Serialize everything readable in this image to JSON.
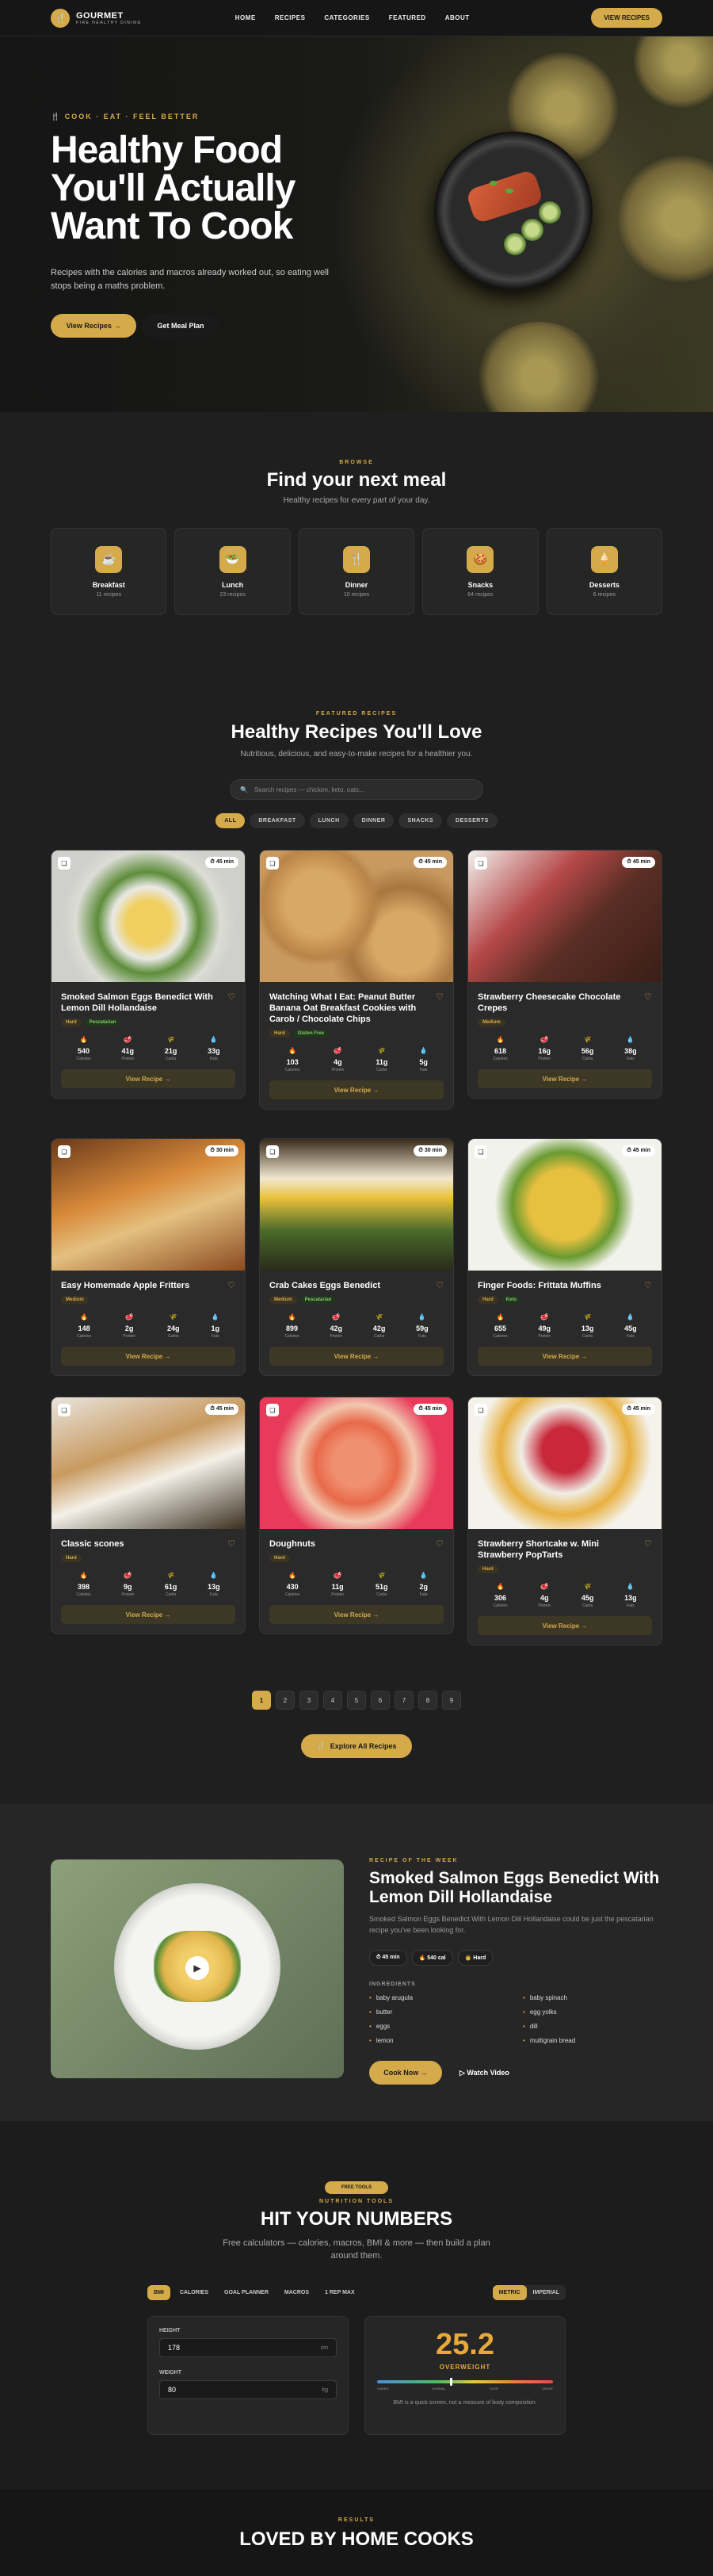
{
  "nav": {
    "brand": "GOURMET",
    "tagline": "FIRE HEALTHY DINING",
    "links": [
      "HOME",
      "RECIPES",
      "CATEGORIES",
      "FEATURED",
      "ABOUT"
    ],
    "cta": "VIEW RECIPES"
  },
  "hero": {
    "eyebrow": "🍴 COOK · EAT · FEEL BETTER",
    "title": "Healthy Food You'll Actually Want To Cook",
    "subtitle": "Recipes with the calories and macros already worked out, so eating well stops being a maths problem.",
    "btn_primary": "View Recipes →",
    "btn_secondary": "Get Meal Plan"
  },
  "browse": {
    "eyebrow": "BROWSE",
    "title": "Find your next meal",
    "subtitle": "Healthy recipes for every part of your day.",
    "categories": [
      {
        "name": "Breakfast",
        "count": "11 recipes"
      },
      {
        "name": "Lunch",
        "count": "23 recipes"
      },
      {
        "name": "Dinner",
        "count": "10 recipes"
      },
      {
        "name": "Snacks",
        "count": "64 recipes"
      },
      {
        "name": "Desserts",
        "count": "6 recipes"
      }
    ]
  },
  "featured": {
    "eyebrow": "FEATURED RECIPES",
    "title": "Healthy Recipes You'll Love",
    "subtitle": "Nutritious, delicious, and easy-to-make recipes for a healthier you.",
    "search_placeholder": "Search recipes — chicken, keto, oats...",
    "filters": [
      "ALL",
      "BREAKFAST",
      "LUNCH",
      "DINNER",
      "SNACKS",
      "DESSERTS"
    ],
    "macro_labels": [
      "Calories",
      "Protein",
      "Carbs",
      "Fats"
    ],
    "view_label": "View Recipe →",
    "recipes": [
      {
        "title": "Smoked Salmon Eggs Benedict With Lemon Dill Hollandaise",
        "time": "45 min",
        "tags": [
          "Hard",
          "Pescatarian"
        ],
        "macros": [
          "540",
          "41g",
          "21g",
          "33g"
        ]
      },
      {
        "title": "Watching What I Eat: Peanut Butter Banana Oat Breakfast Cookies with Carob / Chocolate Chips",
        "time": "45 min",
        "tags": [
          "Hard",
          "Gluten Free"
        ],
        "macros": [
          "103",
          "4g",
          "11g",
          "5g"
        ]
      },
      {
        "title": "Strawberry Cheesecake Chocolate Crepes",
        "time": "45 min",
        "tags": [
          "Medium"
        ],
        "macros": [
          "618",
          "16g",
          "56g",
          "38g"
        ]
      },
      {
        "title": "Easy Homemade Apple Fritters",
        "time": "30 min",
        "tags": [
          "Medium"
        ],
        "macros": [
          "148",
          "2g",
          "24g",
          "1g"
        ]
      },
      {
        "title": "Crab Cakes Eggs Benedict",
        "time": "30 min",
        "tags": [
          "Medium",
          "Pescatarian"
        ],
        "macros": [
          "899",
          "42g",
          "42g",
          "59g"
        ]
      },
      {
        "title": "Finger Foods: Frittata Muffins",
        "time": "45 min",
        "tags": [
          "Hard",
          "Keto"
        ],
        "macros": [
          "655",
          "49g",
          "13g",
          "45g"
        ]
      },
      {
        "title": "Classic scones",
        "time": "45 min",
        "tags": [
          "Hard"
        ],
        "macros": [
          "398",
          "9g",
          "61g",
          "13g"
        ]
      },
      {
        "title": "Doughnuts",
        "time": "45 min",
        "tags": [
          "Hard"
        ],
        "macros": [
          "430",
          "11g",
          "51g",
          "2g"
        ]
      },
      {
        "title": "Strawberry Shortcake w. Mini Strawberry PopTarts",
        "time": "45 min",
        "tags": [
          "Hard"
        ],
        "macros": [
          "306",
          "4g",
          "45g",
          "13g"
        ]
      }
    ],
    "pages": [
      "1",
      "2",
      "3",
      "4",
      "5",
      "6",
      "7",
      "8",
      "9"
    ],
    "explore": "Explore All Recipes"
  },
  "week": {
    "eyebrow": "RECIPE OF THE WEEK",
    "title": "Smoked Salmon Eggs Benedict With Lemon Dill Hollandaise",
    "desc": "Smoked Salmon Eggs Benedict With Lemon Dill Hollandaise could be just the pescatarian recipe you've been looking for.",
    "pills": [
      "⏱ 45 min",
      "🔥 540 cal",
      "👨 Hard"
    ],
    "ingredients_label": "INGREDIENTS",
    "ingredients": [
      "baby arugula",
      "butter",
      "eggs",
      "lemon",
      "baby spinach",
      "egg yolks",
      "dill",
      "multigrain bread"
    ],
    "cook": "Cook Now →",
    "watch": "▷ Watch Video"
  },
  "tools": {
    "badge": "FREE TOOLS",
    "eyebrow": "NUTRITION TOOLS",
    "title": "HIT YOUR NUMBERS",
    "subtitle": "Free calculators — calories, macros, BMI & more — then build a plan around them.",
    "tabs": [
      "BMI",
      "CALORIES",
      "GOAL PLANNER",
      "MACROS",
      "1 REP MAX"
    ],
    "units": [
      "METRIC",
      "IMPERIAL"
    ],
    "height_label": "HEIGHT",
    "height_value": "178",
    "height_unit": "cm",
    "weight_label": "WEIGHT",
    "weight_value": "80",
    "weight_unit": "kg",
    "bmi": "25.2",
    "bmi_category": "OVERWEIGHT",
    "scale": [
      "UNDER",
      "NORMAL",
      "OVER",
      "OBESE"
    ],
    "note": "BMI is a quick screen, not a measure of body composition."
  },
  "results": {
    "eyebrow": "RESULTS",
    "title": "LOVED BY HOME COOKS"
  }
}
